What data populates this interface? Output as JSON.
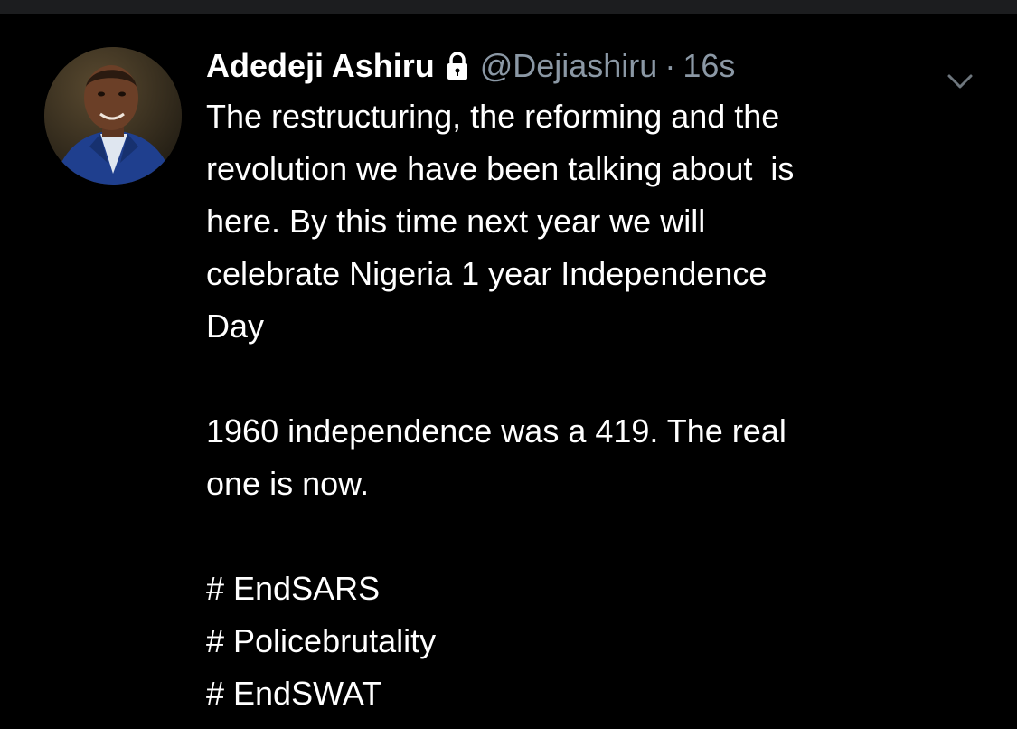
{
  "tweet": {
    "display_name": "Adedeji Ashiru",
    "handle": "@Dejiashiru",
    "separator": "·",
    "time": "16s",
    "paragraph1": [
      "The restructuring, the reforming and the",
      "revolution we have been talking about  is",
      "here. By this time next year we will",
      "celebrate Nigeria 1 year Independence",
      "Day"
    ],
    "paragraph2": [
      "1960 independence was a 419. The real",
      "one is now."
    ],
    "hashtags": [
      "# EndSARS",
      "# Policebrutality",
      "# EndSWAT"
    ]
  },
  "icons": {
    "lock": "lock-icon",
    "caret": "chevron-down-icon"
  },
  "colors": {
    "background": "#000000",
    "text": "#ffffff",
    "secondary": "#8b98a5"
  }
}
